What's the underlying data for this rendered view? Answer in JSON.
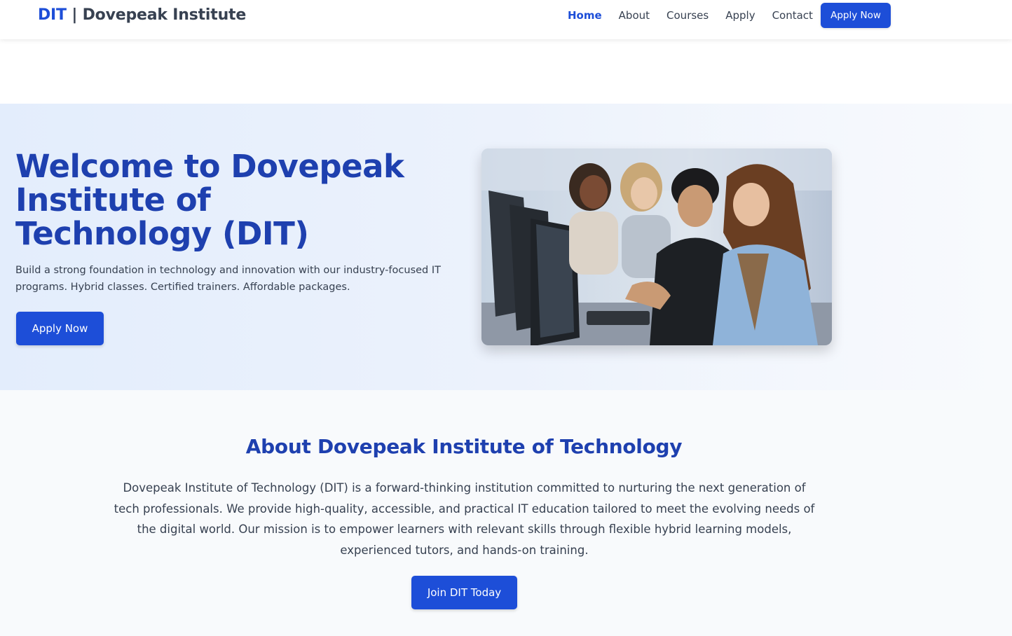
{
  "header": {
    "brand_short": "DIT",
    "brand_rest": " | Dovepeak Institute",
    "nav": [
      "Home",
      "About",
      "Courses",
      "Apply",
      "Contact"
    ],
    "active_nav": "Home",
    "cta_label": "Apply Now"
  },
  "hero": {
    "title": "Welcome to Dovepeak Institute of Technology (DIT)",
    "description": "Build a strong foundation in technology and innovation with our industry-focused IT programs. Hybrid classes. Certified trainers. Affordable packages.",
    "button_label": "Apply Now"
  },
  "about": {
    "title": "About Dovepeak Institute of Technology",
    "description": "Dovepeak Institute of Technology (DIT) is a forward-thinking institution committed to nurturing the next generation of tech professionals. We provide high-quality, accessible, and practical IT education tailored to meet the evolving needs of the digital world. Our mission is to empower learners with relevant skills through flexible hybrid learning models, experienced tutors, and hands-on training.",
    "button_label": "Join DIT Today"
  },
  "colors": {
    "primary": "#1d4ed8",
    "heading": "#1e40af",
    "text": "#374151",
    "hero_bg": "#e3edfc",
    "about_bg": "#f8fafc"
  }
}
